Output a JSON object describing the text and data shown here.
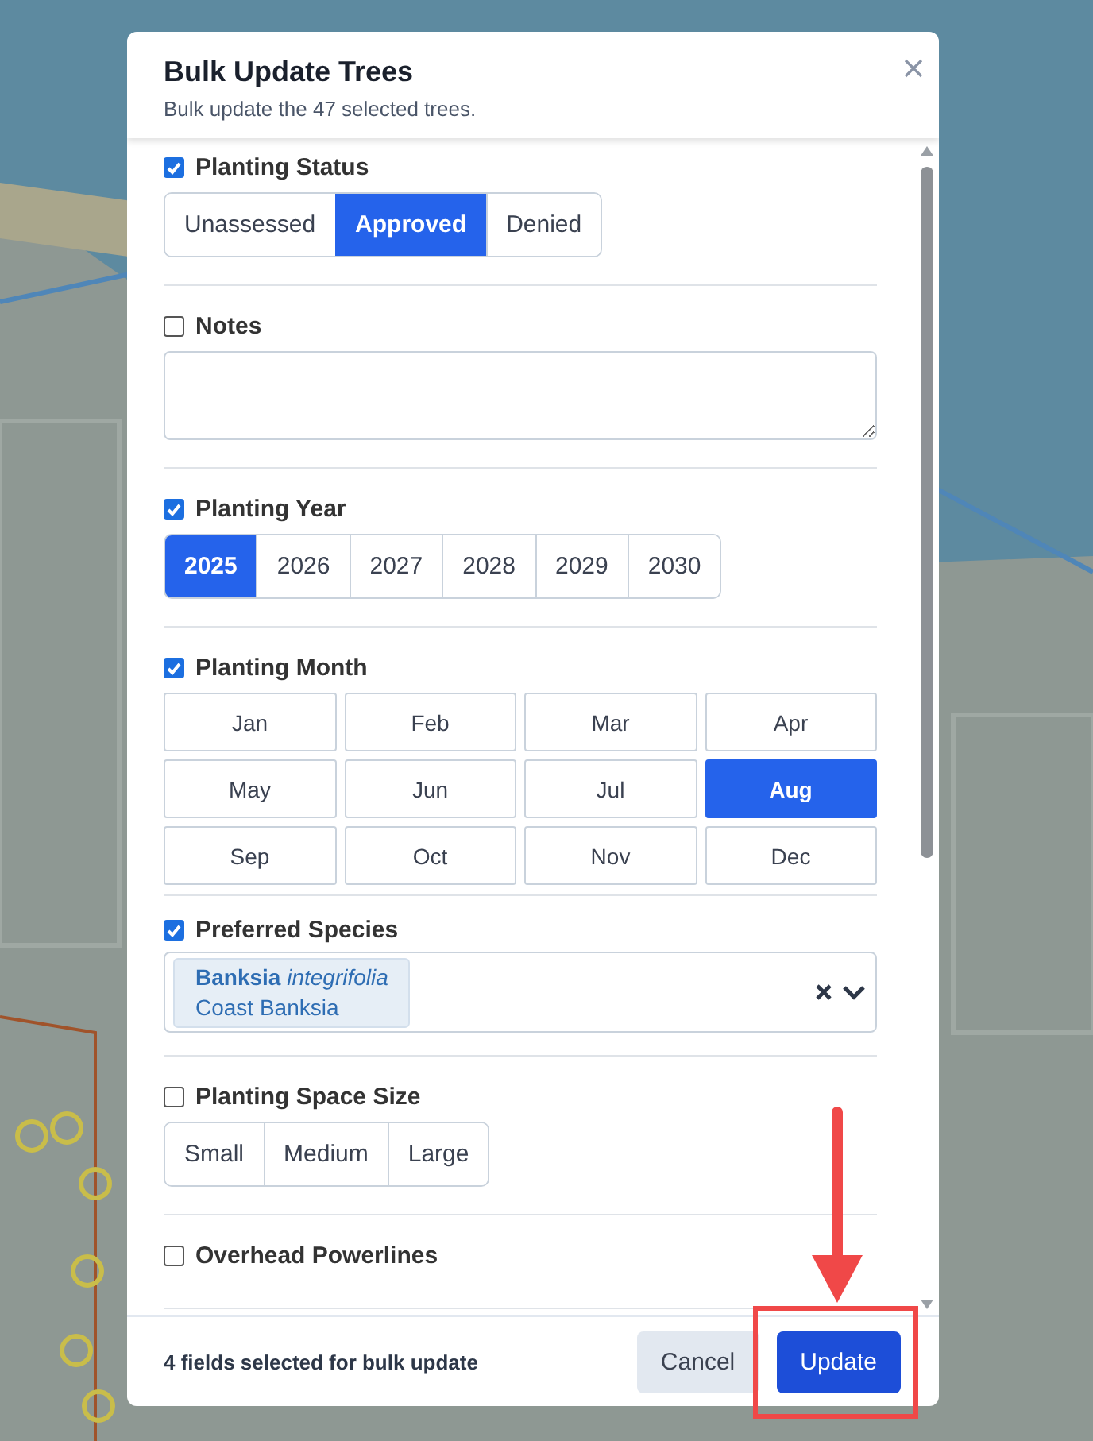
{
  "dialog": {
    "title": "Bulk Update Trees",
    "subtitle": "Bulk update the 47 selected trees."
  },
  "sections": [
    {
      "kind": "segmented",
      "label": "Planting Status",
      "checked": true,
      "options": [
        {
          "label": "Unassessed",
          "selected": false
        },
        {
          "label": "Approved",
          "selected": true
        },
        {
          "label": "Denied",
          "selected": false
        }
      ]
    },
    {
      "kind": "textarea",
      "label": "Notes",
      "checked": false
    },
    {
      "kind": "segmented",
      "label": "Planting Year",
      "checked": true,
      "options": [
        {
          "label": "2025",
          "selected": true
        },
        {
          "label": "2026",
          "selected": false
        },
        {
          "label": "2027",
          "selected": false
        },
        {
          "label": "2028",
          "selected": false
        },
        {
          "label": "2029",
          "selected": false
        },
        {
          "label": "2030",
          "selected": false
        }
      ]
    },
    {
      "kind": "grid",
      "label": "Planting Month",
      "checked": true,
      "options": [
        {
          "label": "Jan",
          "selected": false
        },
        {
          "label": "Feb",
          "selected": false
        },
        {
          "label": "Mar",
          "selected": false
        },
        {
          "label": "Apr",
          "selected": false
        },
        {
          "label": "May",
          "selected": false
        },
        {
          "label": "Jun",
          "selected": false
        },
        {
          "label": "Jul",
          "selected": false
        },
        {
          "label": "Aug",
          "selected": true
        },
        {
          "label": "Sep",
          "selected": false
        },
        {
          "label": "Oct",
          "selected": false
        },
        {
          "label": "Nov",
          "selected": false
        },
        {
          "label": "Dec",
          "selected": false
        }
      ]
    },
    {
      "kind": "multiselect",
      "label": "Preferred Species",
      "checked": true,
      "tags": [
        {
          "name": "**Banksia** *integrifolia*",
          "common_name": "Coast Banksia"
        }
      ]
    },
    {
      "kind": "segmented",
      "label": "Planting Space Size",
      "checked": false,
      "options": [
        {
          "label": "Small",
          "selected": false
        },
        {
          "label": "Medium",
          "selected": false
        },
        {
          "label": "Large",
          "selected": false
        }
      ]
    },
    {
      "kind": "segmented",
      "label": "Overhead Powerlines",
      "checked": false
    }
  ],
  "footer": {
    "summary": "4 fields selected for bulk update",
    "buttons": [
      {
        "label": "Cancel",
        "kind": "secondary"
      },
      {
        "label": "Update",
        "kind": "primary"
      }
    ]
  }
}
